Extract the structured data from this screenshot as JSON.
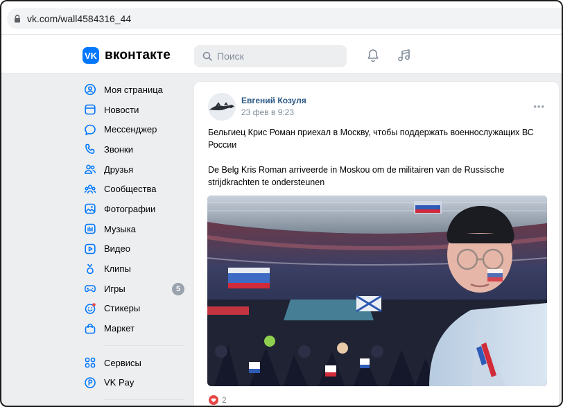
{
  "browser": {
    "url": "vk.com/wall4584316_44"
  },
  "header": {
    "logo_text": "вконтакте",
    "logo_mark": "VK",
    "search_placeholder": "Поиск"
  },
  "sidebar": {
    "items": [
      {
        "label": "Моя страница",
        "icon": "user-circle-icon"
      },
      {
        "label": "Новости",
        "icon": "news-icon"
      },
      {
        "label": "Мессенджер",
        "icon": "message-icon"
      },
      {
        "label": "Звонки",
        "icon": "phone-icon"
      },
      {
        "label": "Друзья",
        "icon": "friends-icon"
      },
      {
        "label": "Сообщества",
        "icon": "communities-icon"
      },
      {
        "label": "Фотографии",
        "icon": "photo-icon"
      },
      {
        "label": "Музыка",
        "icon": "music-icon"
      },
      {
        "label": "Видео",
        "icon": "video-icon"
      },
      {
        "label": "Клипы",
        "icon": "clips-icon"
      },
      {
        "label": "Игры",
        "icon": "games-icon",
        "badge": "5"
      },
      {
        "label": "Стикеры",
        "icon": "stickers-icon"
      },
      {
        "label": "Маркет",
        "icon": "market-icon"
      }
    ],
    "secondary": [
      {
        "label": "Сервисы",
        "icon": "services-icon"
      },
      {
        "label": "VK Pay",
        "icon": "vkpay-icon"
      }
    ]
  },
  "post": {
    "author": "Евгений Козуля",
    "date": "23 фев в 9:23",
    "more_label": "•••",
    "text_ru": "Бельгиец Крис Роман приехал в Москву, чтобы поддержать военнослужащих ВС России",
    "text_nl": "De Belg Kris Roman arriveerde in Moskou om de militairen van de Russische strijdkrachten te ondersteunen",
    "likes": "2"
  },
  "colors": {
    "accent": "#0077ff",
    "link": "#2a5885",
    "background": "#edeef0",
    "like": "#e64646"
  }
}
